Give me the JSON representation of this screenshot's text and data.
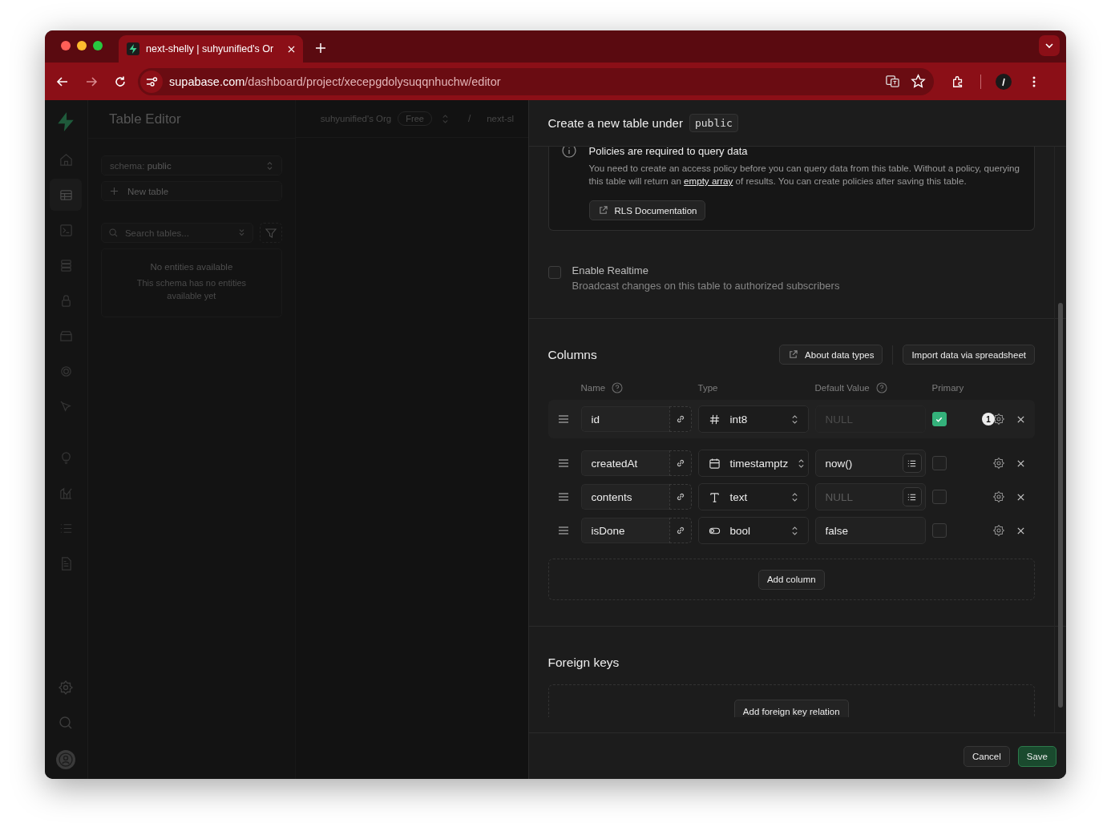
{
  "browser": {
    "tab_title": "next-shelly | suhyunified's Or",
    "url_host": "supabase.com",
    "url_path": "/dashboard/project/xecepgdolysuqqnhuchw/editor"
  },
  "nav_rail": [
    {
      "selected": false
    },
    {
      "selected": true
    },
    {
      "selected": false
    },
    {
      "selected": false
    },
    {
      "selected": false
    },
    {
      "selected": false
    },
    {
      "selected": false
    },
    {
      "selected": false
    },
    {
      "selected": false
    },
    {
      "selected": false
    },
    {
      "selected": false
    },
    {
      "selected": false
    }
  ],
  "sidebar": {
    "title": "Table Editor",
    "schema_label": "schema:",
    "schema_value": "public",
    "new_table": "New table",
    "search_placeholder": "Search tables...",
    "empty_title": "No entities available",
    "empty_text": "This schema has no entities available yet"
  },
  "topbar": {
    "org": "suhyunified's Org",
    "plan": "Free",
    "separator": "/",
    "project": "next-sl"
  },
  "panel": {
    "title": "Create a new table under",
    "schema": "public",
    "notice": {
      "title": "Policies are required to query data",
      "text_before": "You need to create an access policy before you can query data from this table. Without a policy, querying this table will return an",
      "link": "empty array",
      "text_after": "of results. You can create policies after saving this table.",
      "button": "RLS Documentation"
    },
    "realtime": {
      "label": "Enable Realtime",
      "description": "Broadcast changes on this table to authorized subscribers",
      "checked": false
    },
    "columns": {
      "heading": "Columns",
      "buttons": [
        "About data types",
        "Import data via spreadsheet"
      ],
      "headers": [
        {
          "label": "Name",
          "help": true
        },
        {
          "label": "Type",
          "help": false
        },
        {
          "label": "Default Value",
          "help": true
        },
        {
          "label": "Primary",
          "help": false
        }
      ],
      "rows": [
        {
          "name": "id",
          "type": "int8",
          "kind": "number",
          "default_placeholder": "NULL",
          "default_disabled": true,
          "list_button": false,
          "primary": true,
          "badge": "1"
        },
        {
          "name": "createdAt",
          "type": "timestamptz",
          "kind": "date",
          "default": "now()",
          "default_disabled": false,
          "list_button": true,
          "primary": false
        },
        {
          "name": "contents",
          "type": "text",
          "kind": "text",
          "default_placeholder": "NULL",
          "default_disabled": false,
          "list_button": true,
          "primary": false
        },
        {
          "name": "isDone",
          "type": "bool",
          "kind": "toggle",
          "default": "false",
          "default_disabled": false,
          "list_button": false,
          "primary": false
        }
      ],
      "add_button": "Add column"
    },
    "foreign_keys": {
      "heading": "Foreign keys",
      "add_button": "Add foreign key relation"
    },
    "footer": {
      "cancel": "Cancel",
      "save": "Save"
    }
  }
}
